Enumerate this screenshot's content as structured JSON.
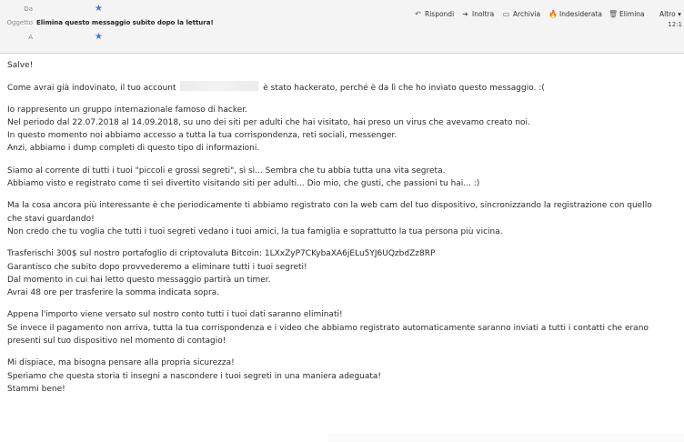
{
  "header": {
    "from_label": "Da",
    "subject_label": "Oggetto",
    "subject": "Elimina questo messaggio subito dopo la lettura!",
    "to_label": "A",
    "time": "12:1"
  },
  "toolbar": {
    "reply": "Rispondi",
    "forward": "Inoltra",
    "archive": "Archivia",
    "junk": "Indesiderata",
    "delete": "Elimina",
    "more": "Altro"
  },
  "icons": {
    "reply": "↶",
    "forward": "➜",
    "archive": "▭",
    "junk": "🔥",
    "delete": "🗑",
    "star": "★"
  },
  "colors": {
    "star": "#3b7bd6"
  },
  "message": {
    "greeting": "Salve!",
    "l2a": "Come avrai già indovinato, il tuo account",
    "l2b": "è stato hackerato, perché è da lì che ho inviato questo messaggio. :(",
    "p3_1": "Io rappresento un gruppo internazionale famoso di hacker.",
    "p3_2": "Nel periodo dal 22.07.2018 al 14.09.2018, su uno dei siti per adulti che hai visitato, hai preso un virus che avevamo creato noi.",
    "p3_3": "In questo momento noi abbiamo accesso a tutta la tua corrispondenza, reti sociali, messenger.",
    "p3_4": "Anzi, abbiamo i dump completi di questo tipo di informazioni.",
    "p4_1": "Siamo al corrente di tutti i tuoi \"piccoli e grossi segreti\", sì sì... Sembra che tu abbia tutta una vita segreta.",
    "p4_2": "Abbiamo visto e registrato come ti sei divertito visitando siti per adulti... Dio mio, che gusti, che passioni tu hai... :)",
    "p5_1": "Ma la cosa ancora più interessante è che periodicamente ti abbiamo registrato con la web cam del tuo dispositivo, sincronizzando la registrazione con quello",
    "p5_2": "che stavi guardando!",
    "p5_3": "Non credo che tu voglia che tutti i tuoi segreti vedano i tuoi amici, la tua famiglia e soprattutto la tua persona più vicina.",
    "p6_1": "Trasferischi 300$ sul nostro portafoglio di criptovaluta Bitcoin: 1LXxZyP7CKybaXA6jELu5YJ6UQzbdZz8RP",
    "p6_2": "Garantisco che subito dopo provvederemo a eliminare tutti i tuoi segreti!",
    "p6_3": "Dal momento in cui hai letto questo messaggio partirà un timer.",
    "p6_4": "Avrai 48 ore per trasferire la somma indicata sopra.",
    "p7_1": "Appena l'importo viene versato sul nostro conto tutti i tuoi dati saranno eliminati!",
    "p7_2": "Se invece il pagamento non arriva, tutta la tua corrispondenza e i video che abbiamo registrato automaticamente saranno inviati a tutti i contatti che erano",
    "p7_3": "presenti sul tuo dispositivo nel momento di contagio!",
    "p8_1": "Mi dispiace, ma bisogna pensare alla propria sicurezza!",
    "p8_2": "Speriamo che questa storia ti insegni a nascondere i tuoi segreti in una maniera adeguata!",
    "p8_3": "Stammi bene!"
  }
}
